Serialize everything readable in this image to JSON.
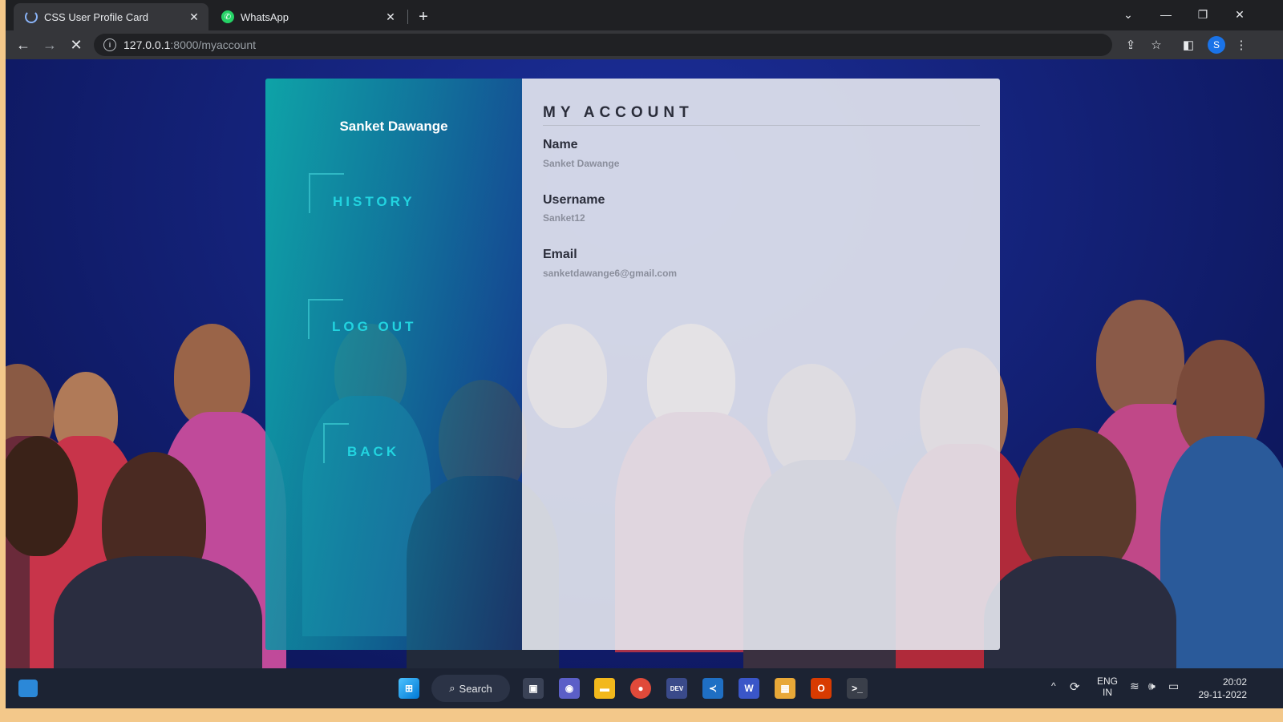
{
  "browser": {
    "tabs": [
      {
        "title": "CSS User Profile Card",
        "active": true,
        "icon": "loading-spinner-icon"
      },
      {
        "title": "WhatsApp",
        "active": false,
        "icon": "whatsapp-icon"
      }
    ],
    "url_host": "127.0.0.1",
    "url_path": ":8000/myaccount",
    "profile_initial": "S"
  },
  "sidebar": {
    "user_name": "Sanket Dawange",
    "nav": [
      {
        "label": "HISTORY"
      },
      {
        "label": "LOG OUT"
      },
      {
        "label": "BACK"
      }
    ]
  },
  "account": {
    "title": "MY ACCOUNT",
    "fields": [
      {
        "label": "Name",
        "value": "Sanket Dawange"
      },
      {
        "label": "Username",
        "value": "Sanket12"
      },
      {
        "label": "Email",
        "value": "sanketdawange6@gmail.com"
      }
    ]
  },
  "taskbar": {
    "search_label": "Search",
    "lang_top": "ENG",
    "lang_bottom": "IN",
    "time": "20:02",
    "date": "29-11-2022"
  },
  "colors": {
    "accent": "#22d4e0",
    "sidebar": "#0eaaaa",
    "panel": "#e6e8f0"
  }
}
